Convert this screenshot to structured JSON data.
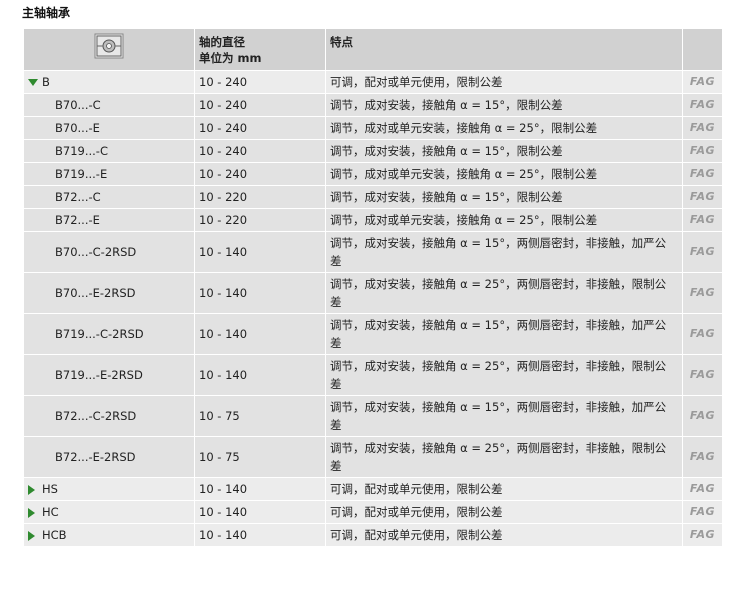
{
  "page": {
    "title": "主轴轴承"
  },
  "table": {
    "headers": {
      "diameter_line1": "轴的直径",
      "diameter_line2": "单位为 mm",
      "features": "特点"
    },
    "rows": [
      {
        "name": "B",
        "diameter": "10 - 240",
        "features": "可调，配对或单元使用，限制公差",
        "brand": "FAG"
      },
      {
        "name": "B70...-C",
        "diameter": "10 - 240",
        "features": "调节，成对安装，接触角 α = 15°，限制公差",
        "brand": "FAG"
      },
      {
        "name": "B70...-E",
        "diameter": "10 - 240",
        "features": "调节，成对或单元安装，接触角 α = 25°，限制公差",
        "brand": "FAG"
      },
      {
        "name": "B719...-C",
        "diameter": "10 - 240",
        "features": "调节，成对安装，接触角 α = 15°，限制公差",
        "brand": "FAG"
      },
      {
        "name": "B719...-E",
        "diameter": "10 - 240",
        "features": "调节，成对或单元安装，接触角 α = 25°，限制公差",
        "brand": "FAG"
      },
      {
        "name": "B72...-C",
        "diameter": "10 - 220",
        "features": "调节，成对安装，接触角 α = 15°，限制公差",
        "brand": "FAG"
      },
      {
        "name": "B72...-E",
        "diameter": "10 - 220",
        "features": "调节，成对或单元安装，接触角 α = 25°，限制公差",
        "brand": "FAG"
      },
      {
        "name": "B70...-C-2RSD",
        "diameter": "10 - 140",
        "features": "调节，成对安装，接触角 α = 15°，两侧唇密封，非接触，加严公差",
        "brand": "FAG"
      },
      {
        "name": "B70...-E-2RSD",
        "diameter": "10 - 140",
        "features": "调节，成对安装，接触角 α = 25°，两侧唇密封，非接触，限制公差",
        "brand": "FAG"
      },
      {
        "name": "B719...-C-2RSD",
        "diameter": "10 - 140",
        "features": "调节，成对安装，接触角 α = 15°，两侧唇密封，非接触，加严公差",
        "brand": "FAG"
      },
      {
        "name": "B719...-E-2RSD",
        "diameter": "10 - 140",
        "features": "调节，成对安装，接触角 α = 25°，两侧唇密封，非接触，限制公差",
        "brand": "FAG"
      },
      {
        "name": "B72...-C-2RSD",
        "diameter": "10 - 75",
        "features": "调节，成对安装，接触角 α = 15°，两侧唇密封，非接触，加严公差",
        "brand": "FAG"
      },
      {
        "name": "B72...-E-2RSD",
        "diameter": "10 - 75",
        "features": "调节，成对安装，接触角 α = 25°，两侧唇密封，非接触，限制公差",
        "brand": "FAG"
      },
      {
        "name": "HS",
        "diameter": "10 - 140",
        "features": "可调，配对或单元使用，限制公差",
        "brand": "FAG"
      },
      {
        "name": "HC",
        "diameter": "10 - 140",
        "features": "可调，配对或单元使用，限制公差",
        "brand": "FAG"
      },
      {
        "name": "HCB",
        "diameter": "10 - 140",
        "features": "可调，配对或单元使用，限制公差",
        "brand": "FAG"
      }
    ]
  },
  "icons": {
    "header_image": "bearing-cross-section-icon",
    "expanded": "triangle-down-icon",
    "collapsed": "triangle-right-icon"
  },
  "colors": {
    "expander": "#2f8a2f",
    "header_bg": "#d1d1d1",
    "brand_text": "#9a9a9a"
  }
}
